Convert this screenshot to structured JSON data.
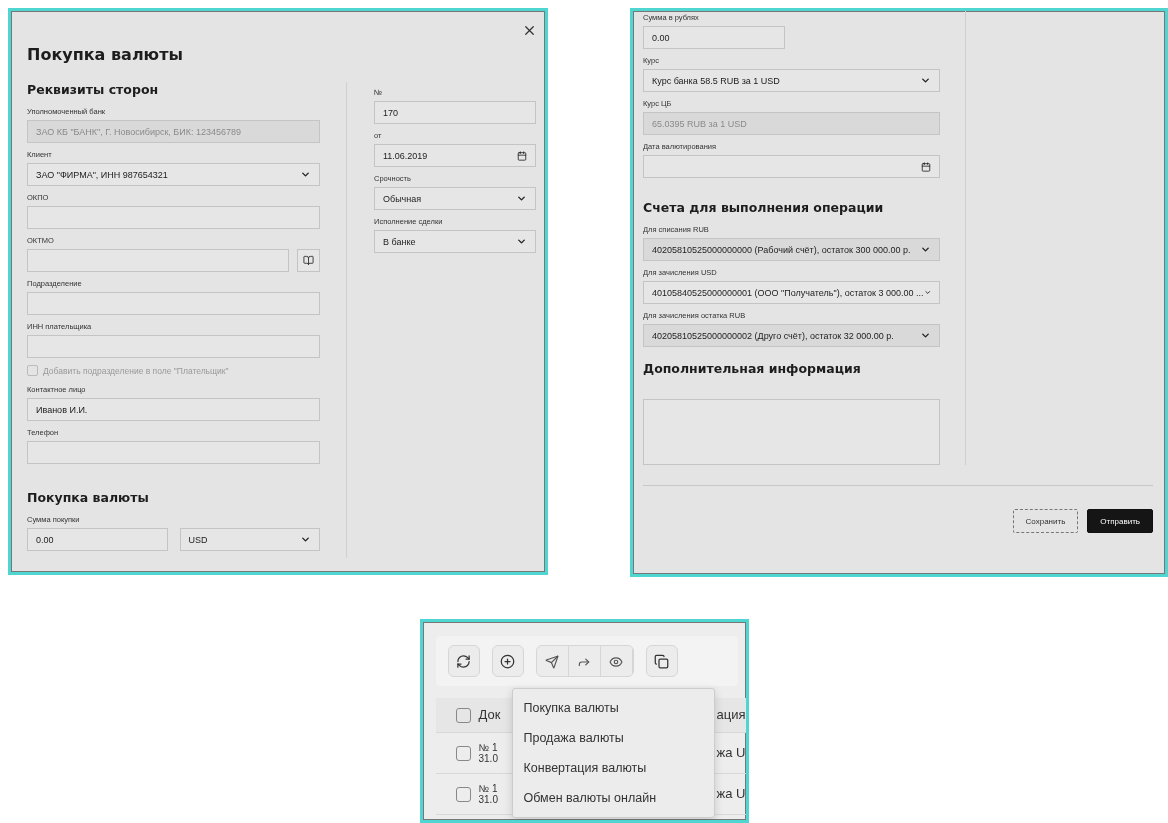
{
  "purchase_dialog": {
    "title": "Покупка валюты",
    "sections": [
      {
        "heading": "Реквизиты сторон",
        "fields": [
          {
            "kind": "text",
            "label": "Уполномоченный банк",
            "value": "ЗАО КБ \"БАНК\", Г. Новосибирск, БИК: 123456789",
            "disabled": true
          },
          {
            "kind": "select",
            "label": "Клиент",
            "value": "ЗАО \"ФИРМА\", ИНН 987654321",
            "disabled": false
          },
          {
            "kind": "text",
            "label": "ОКПО",
            "disabled": false
          },
          {
            "kind": "lookup",
            "label": "ОКТМО",
            "disabled": false
          },
          {
            "kind": "text",
            "label": "Подразделение",
            "disabled": false
          },
          {
            "kind": "text",
            "label": "ИНН плательщика",
            "disabled": false
          },
          {
            "kind": "checkbox",
            "label": "Добавить подразделение в поле \"Плательщик\"",
            "checked": false,
            "disabled": true
          },
          {
            "kind": "text",
            "label": "Контактное лицо",
            "value": "Иванов И.И.",
            "disabled": false
          },
          {
            "kind": "text",
            "label": "Телефон",
            "disabled": false
          }
        ]
      },
      {
        "heading": "Покупка валюты",
        "fields": [
          {
            "kind": "text",
            "label": "Сумма покупки",
            "value": "0.00",
            "disabled": false,
            "half": true
          },
          {
            "kind": "select",
            "value": "USD",
            "disabled": false,
            "half": true
          }
        ]
      }
    ],
    "side_fields": [
      {
        "kind": "text",
        "label": "№",
        "value": "170",
        "disabled": false
      },
      {
        "kind": "date",
        "label": "от",
        "value": "11.06.2019",
        "disabled": false
      },
      {
        "kind": "select",
        "label": "Срочность",
        "value": "Обычная",
        "disabled": false
      },
      {
        "kind": "select",
        "label": "Исполнение сделки",
        "value": "В банке",
        "disabled": false
      }
    ]
  },
  "purchase_dialog_bottom": {
    "fields": [
      {
        "kind": "text",
        "label": "Сумма в рублях",
        "value": "0.00",
        "disabled": false,
        "half": true
      },
      {
        "kind": "select",
        "label": "Курс",
        "value": "Курс банка 58.5 RUB за 1 USD",
        "disabled": false
      },
      {
        "kind": "text",
        "label": "Курс ЦБ",
        "value": "65.0395 RUB за 1 USD",
        "disabled": true
      },
      {
        "kind": "date",
        "label": "Дата валютирования",
        "disabled": false
      }
    ],
    "sections": [
      {
        "heading": "Счета для выполнения операции",
        "fields": [
          {
            "kind": "select",
            "label": "Для списания RUB",
            "value": "40205810525000000000 (Рабочий счёт), остаток 300 000.00 р.",
            "disabled": true
          },
          {
            "kind": "select",
            "label": "Для зачисления USD",
            "value": "40105840525000000001 (ООО \"Получатель\"), остаток 3 000.00 ...",
            "disabled": false
          },
          {
            "kind": "select",
            "label": "Для зачисления остатка RUB",
            "value": "40205810525000000002 (Друго счёт), остаток 32 000.00 р.",
            "disabled": true
          }
        ]
      },
      {
        "heading": "Дополнительная информация",
        "fields": [
          {
            "kind": "textarea",
            "disabled": false
          }
        ]
      }
    ],
    "buttons": [
      {
        "label": "Сохранить",
        "kind": "secondary"
      },
      {
        "label": "Отправить",
        "kind": "primary"
      }
    ]
  },
  "documents_list": {
    "toolbar": [
      {
        "kind": "refresh"
      },
      {
        "kind": "add"
      },
      {
        "kind": "send"
      },
      {
        "kind": "send-multi"
      },
      {
        "kind": "view"
      },
      {
        "kind": "copy"
      }
    ],
    "header": {
      "checked": false,
      "columns": [
        "Док",
        "ация"
      ]
    },
    "rows": [
      {
        "checked": false,
        "column_1": [
          "№ 1",
          "31.0"
        ],
        "column_2": "жа U"
      },
      {
        "checked": false,
        "column_1": [
          "№ 1",
          "31.0"
        ],
        "column_2": "жа U"
      }
    ],
    "menu": [
      "Покупка валюты",
      "Продажа валюты",
      "Конвертация валюты",
      "Обмен валюты онлайн"
    ]
  }
}
